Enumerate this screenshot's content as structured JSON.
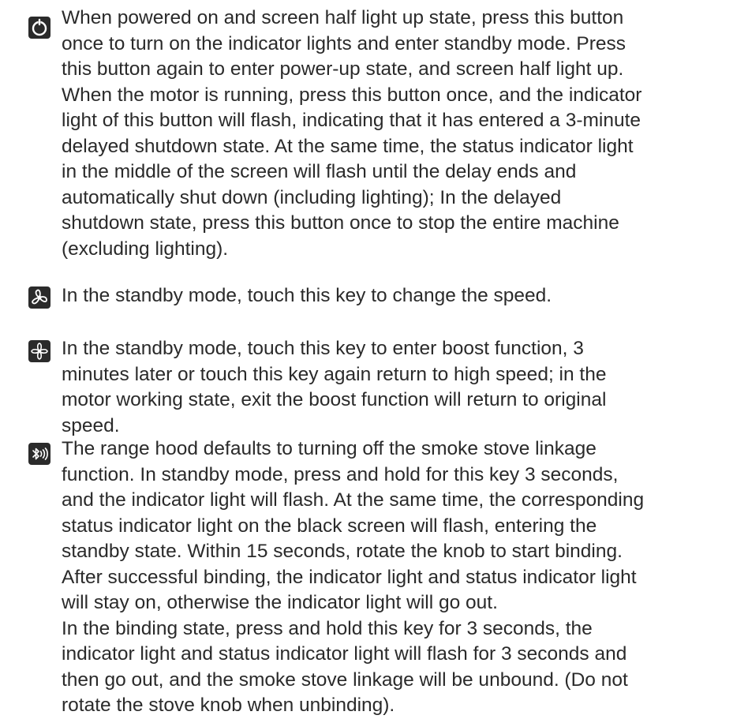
{
  "items": [
    {
      "icon": "power-icon",
      "lines": [
        "When powered on and screen half light up state, press this button",
        "once to turn on the indicator lights and enter standby mode. Press",
        "this button again to enter power-up state, and screen half light up.",
        "When the motor is running, press this button once, and the indicator",
        "light of this button will flash, indicating that it has entered a 3-minute",
        "delayed shutdown state. At the same time, the status indicator light",
        "in the middle of the screen will flash until the delay ends and",
        "automatically shut down (including lighting); In the delayed",
        "shutdown state, press this button once to stop the entire machine",
        "(excluding lighting)."
      ]
    },
    {
      "icon": "fan-speed-icon",
      "lines": [
        "In the standby mode, touch this key to change the speed."
      ]
    },
    {
      "icon": "boost-fan-icon",
      "lines": [
        "In the standby mode, touch this key to enter boost function, 3",
        "minutes later or touch this key again return to high speed; in the",
        "motor working state, exit the boost function will return to original",
        "speed."
      ]
    },
    {
      "icon": "bluetooth-linkage-icon",
      "lines": [
        "The range hood defaults to turning off the smoke stove linkage",
        "function. In standby mode, press and hold for this key 3 seconds,",
        "and the indicator light will flash. At the same time, the corresponding",
        "status indicator light on the black screen will flash, entering the",
        "standby state. Within 15 seconds, rotate the knob to start binding.",
        "After successful binding, the indicator light and status indicator light",
        "will stay on, otherwise the indicator light will go out.",
        "In the binding state, press and hold this key for 3 seconds, the",
        "indicator light and status indicator light will flash for 3 seconds and",
        "then go out, and the smoke stove linkage will be unbound. (Do not",
        "rotate the stove knob when unbinding)."
      ]
    }
  ]
}
